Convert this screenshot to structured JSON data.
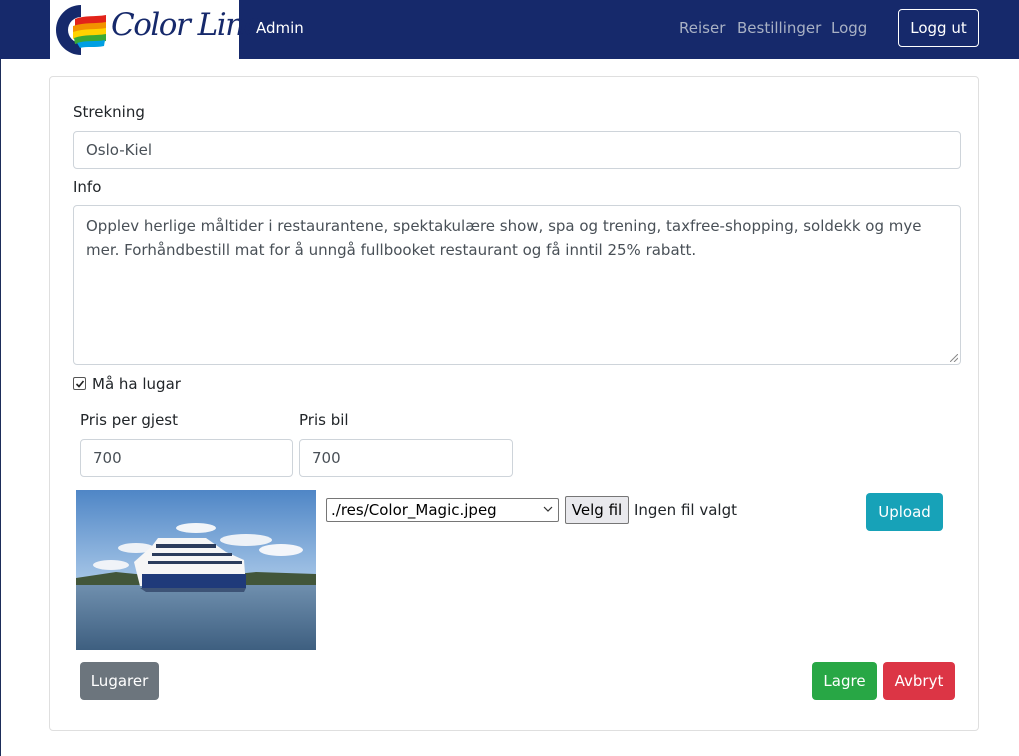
{
  "navbar": {
    "logo_text": "Color Line",
    "brand": "Admin",
    "links": [
      "Reiser",
      "Bestillinger",
      "Logg"
    ],
    "logout_label": "Logg ut"
  },
  "form": {
    "route_label": "Strekning",
    "route_value": "Oslo-Kiel",
    "info_label": "Info",
    "info_value": "Opplev herlige måltider i restaurantene, spektakulære show, spa og trening, taxfree-shopping, soldekk og mye mer. Forhåndbestill mat for å unngå fullbooket restaurant og få inntil 25% rabatt.",
    "cabin_checkbox_label": "Må ha lugar",
    "cabin_checked": true,
    "price_guest_label": "Pris per gjest",
    "price_guest_value": "700",
    "price_car_label": "Pris bil",
    "price_car_value": "700",
    "image_select_value": "./res/Color_Magic.jpeg",
    "file_button_label": "Velg fil",
    "file_status": "Ingen fil valgt",
    "upload_label": "Upload",
    "cabins_button_label": "Lugarer",
    "save_label": "Lagre",
    "cancel_label": "Avbryt"
  },
  "colors": {
    "navbar": "#16296b",
    "upload": "#17a2b8",
    "secondary": "#6c757d",
    "success": "#28a745",
    "danger": "#dc3545"
  },
  "icons": [
    "color-line-logo-icon",
    "checkbox-checked-icon",
    "chevron-down-icon",
    "resize-grip-icon"
  ]
}
